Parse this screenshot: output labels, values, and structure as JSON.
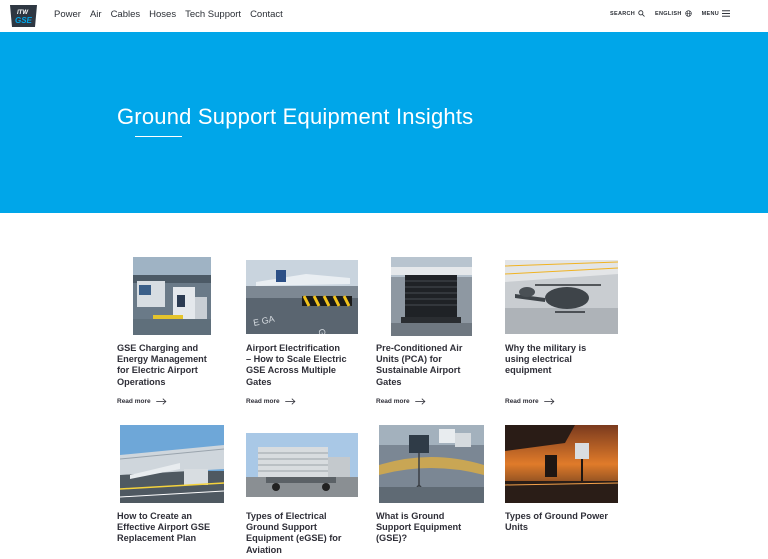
{
  "brand": {
    "logo_text_top": "ITW",
    "logo_text_bottom": "GSE",
    "colors": {
      "accent": "#00a6e9",
      "logo_bg": "#2e3742",
      "logo_accent": "#00a6e9"
    }
  },
  "nav": [
    "Power",
    "Air",
    "Cables",
    "Hoses",
    "Tech Support",
    "Contact"
  ],
  "tools": {
    "search_label": "SEARCH",
    "search_icon": "search-icon",
    "language_label": "ENGLISH",
    "language_icon": "globe-icon",
    "menu_label": "MENU",
    "menu_icon": "hamburger-icon"
  },
  "hero": {
    "title": "Ground Support Equipment Insights"
  },
  "cards": [
    {
      "title_lines": [
        "GSE Charging and",
        "Energy Management",
        "for Electric Airport",
        "Operations"
      ],
      "read_more": "Read more"
    },
    {
      "title_lines": [
        "Airport Electrification",
        "– How to Scale Electric",
        "GSE Across Multiple",
        "Gates"
      ],
      "read_more": "Read more"
    },
    {
      "title_lines": [
        "Pre-Conditioned Air",
        "Units (PCA) for",
        "Sustainable Airport",
        "Gates"
      ],
      "read_more": "Read more"
    },
    {
      "title_lines": [
        "Why the military is",
        "using electrical",
        "equipment"
      ],
      "read_more": "Read more"
    },
    {
      "title_lines": [
        "How to Create an",
        "Effective Airport GSE",
        "Replacement Plan"
      ],
      "read_more": ""
    },
    {
      "title_lines": [
        "Types of Electrical",
        "Ground Support",
        "Equipment (eGSE) for",
        "Aviation"
      ],
      "read_more": ""
    },
    {
      "title_lines": [
        "What is Ground",
        "Support Equipment",
        "(GSE)?"
      ],
      "read_more": ""
    },
    {
      "title_lines": [
        "Types of Ground Power",
        "Units"
      ],
      "read_more": ""
    }
  ]
}
